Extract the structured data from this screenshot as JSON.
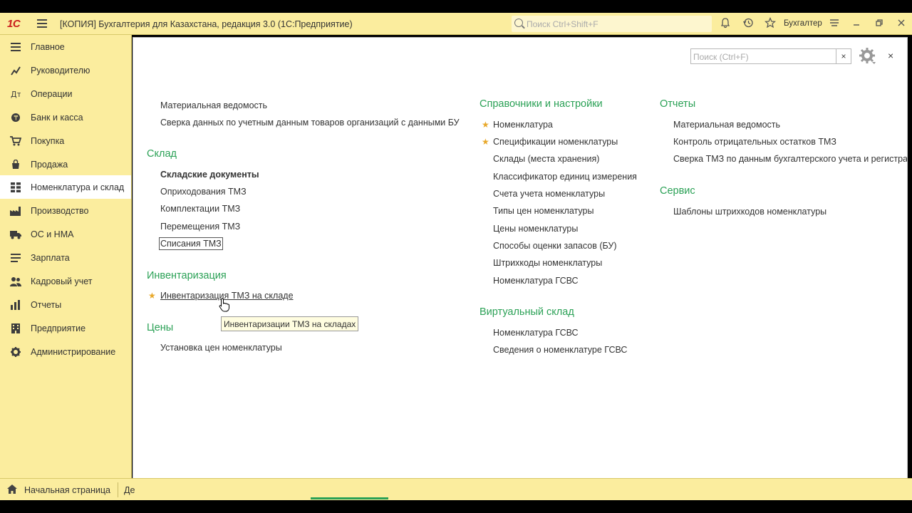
{
  "app": {
    "logo": "1С",
    "title": "[КОПИЯ] Бухгалтерия для Казахстана, редакция 3.0  (1С:Предприятие)",
    "search_placeholder": "Поиск Ctrl+Shift+F",
    "user": "Бухгалтер"
  },
  "sidebar": {
    "items": [
      {
        "label": "Главное",
        "icon": "list-icon"
      },
      {
        "label": "Руководителю",
        "icon": "chart-icon"
      },
      {
        "label": "Операции",
        "icon": "operations-icon"
      },
      {
        "label": "Банк и касса",
        "icon": "bank-icon"
      },
      {
        "label": "Покупка",
        "icon": "cart-icon"
      },
      {
        "label": "Продажа",
        "icon": "sale-icon"
      },
      {
        "label": "Номенклатура и склад",
        "icon": "grid-icon"
      },
      {
        "label": "Производство",
        "icon": "factory-icon"
      },
      {
        "label": "ОС и НМА",
        "icon": "truck-icon"
      },
      {
        "label": "Зарплата",
        "icon": "salary-icon"
      },
      {
        "label": "Кадровый учет",
        "icon": "people-icon"
      },
      {
        "label": "Отчеты",
        "icon": "bar-chart-icon"
      },
      {
        "label": "Предприятие",
        "icon": "building-icon"
      },
      {
        "label": "Администрирование",
        "icon": "gear-icon"
      }
    ]
  },
  "panel": {
    "search_placeholder": "Поиск (Ctrl+F)",
    "clear": "×",
    "close": "×",
    "col1": {
      "top_links": [
        "Материальная ведомость",
        "Сверка данных по учетным данным товаров организаций с данными БУ"
      ],
      "sklad": {
        "title": "Склад",
        "header": "Складские документы",
        "links": [
          "Оприходования ТМЗ",
          "Комплектации ТМЗ",
          "Перемещения ТМЗ",
          "Списания ТМЗ"
        ]
      },
      "inventory": {
        "title": "Инвентаризация",
        "links": [
          "Инвентаризация ТМЗ на складе"
        ]
      },
      "prices": {
        "title": "Цены",
        "links": [
          "Установка цен номенклатуры"
        ]
      }
    },
    "col2": {
      "ref": {
        "title": "Справочники и настройки",
        "links": [
          "Номенклатура",
          "Спецификации номенклатуры",
          "Склады (места хранения)",
          "Классификатор единиц измерения",
          "Счета учета номенклатуры",
          "Типы цен номенклатуры",
          "Цены номенклатуры",
          "Способы оценки запасов (БУ)",
          "Штрихкоды номенклатуры",
          "Номенклатура ГСВС"
        ]
      },
      "virtual": {
        "title": "Виртуальный склад",
        "links": [
          "Номенклатура ГСВС",
          "Сведения о номенклатуре ГСВС"
        ]
      }
    },
    "col3": {
      "reports": {
        "title": "Отчеты",
        "links": [
          "Материальная ведомость",
          "Контроль отрицательных остатков ТМЗ",
          "Сверка ТМЗ по данным бухгалтерского учета и регистра \""
        ]
      },
      "service": {
        "title": "Сервис",
        "links": [
          "Шаблоны штрихкодов номенклатуры"
        ]
      }
    },
    "tooltip": "Инвентаризации ТМЗ на складах"
  },
  "bottom": {
    "home": "Начальная страница",
    "tab": "Де"
  },
  "colors": {
    "panel_bg": "#fbed9e",
    "section_title": "#2ba156",
    "star": "#e8a82a",
    "logo": "#c91d1d"
  }
}
